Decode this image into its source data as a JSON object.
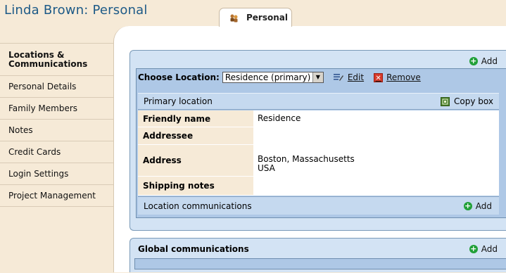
{
  "page": {
    "title": "Linda Brown: Personal"
  },
  "tab": {
    "label": "Personal",
    "icon": "people-icon"
  },
  "sidebar": {
    "items": [
      {
        "label": "Locations & Communications"
      },
      {
        "label": "Personal Details"
      },
      {
        "label": "Family Members"
      },
      {
        "label": "Notes"
      },
      {
        "label": "Credit Cards"
      },
      {
        "label": "Login Settings"
      },
      {
        "label": "Project Management"
      }
    ]
  },
  "locations": {
    "add_label": "Add",
    "choose_label": "Choose Location:",
    "selected_location": "Residence (primary)",
    "edit_label": "Edit",
    "remove_label": "Remove",
    "primary_location_label": "Primary location",
    "copy_box_label": "Copy box",
    "fields": {
      "friendly_name_label": "Friendly name",
      "friendly_name_value": "Residence",
      "addressee_label": "Addressee",
      "addressee_value": "",
      "address_label": "Address",
      "address_line1": "Boston, Massachusetts",
      "address_line2": "USA",
      "shipping_notes_label": "Shipping notes",
      "shipping_notes_value": ""
    },
    "location_communications_label": "Location communications",
    "location_communications_add": "Add"
  },
  "global_communications": {
    "title": "Global communications",
    "add_label": "Add"
  },
  "colors": {
    "title": "#1d5a87",
    "sidebar_bg": "#f6ead7",
    "panel_blue": "#aec8e6",
    "box_blue": "#d3e3f4",
    "add_green": "#21a038",
    "remove_red": "#d83a2a"
  }
}
